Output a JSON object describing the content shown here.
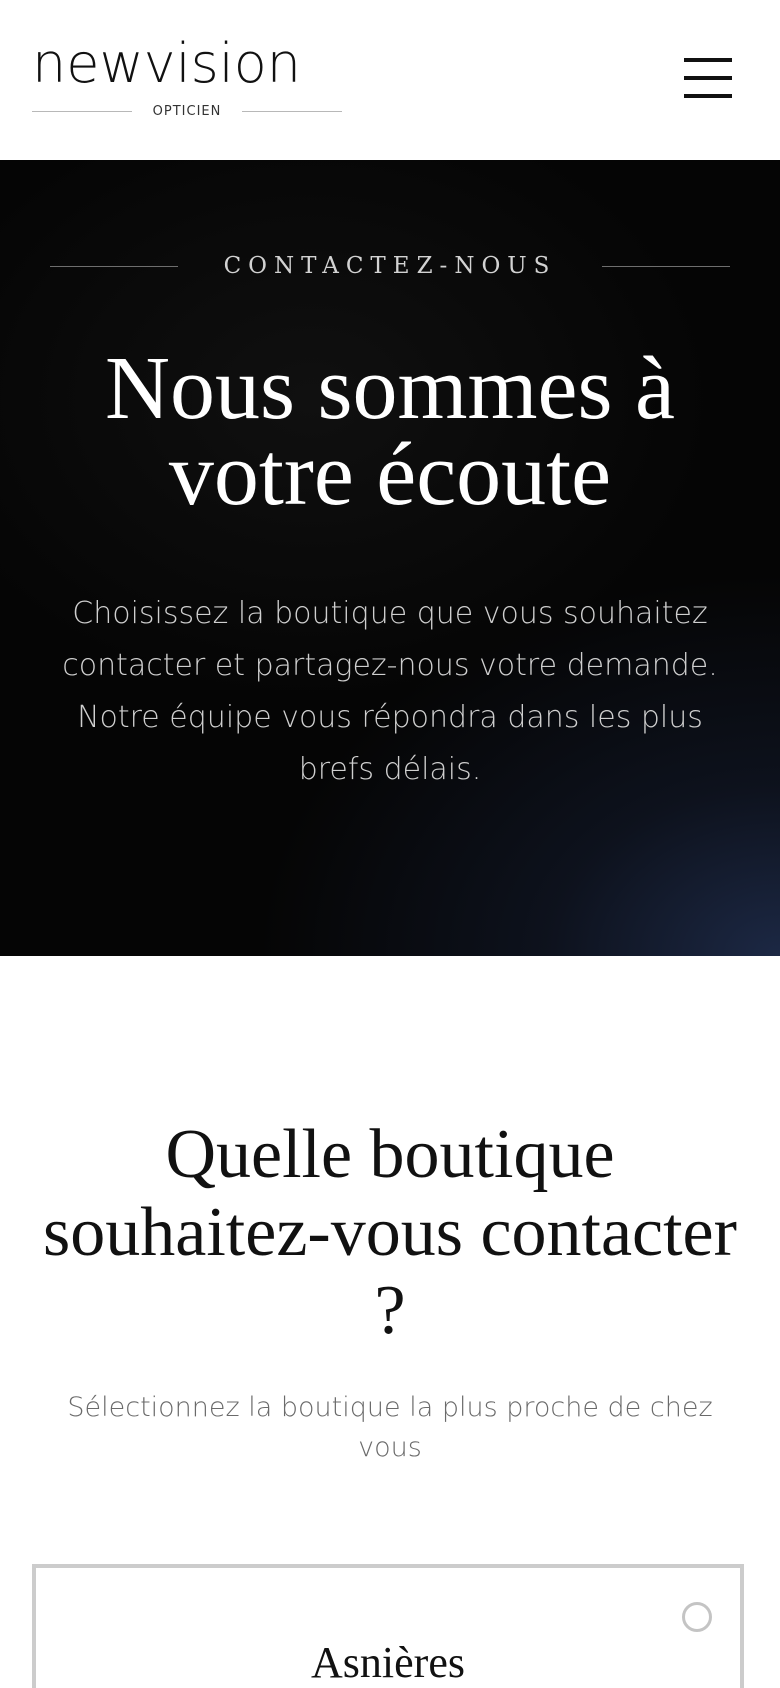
{
  "header": {
    "logo_text": "newvision",
    "logo_subtitle": "OPTICIEN",
    "menu_icon": "hamburger-menu-icon"
  },
  "hero": {
    "eyebrow": "CONTACTEZ-NOUS",
    "title": "Nous sommes à votre écoute",
    "description": "Choisissez la boutique que vous souhaitez contacter et partagez-nous votre demande. Notre équipe vous répondra dans les plus brefs délais."
  },
  "store_section": {
    "title": "Quelle boutique souhaitez-vous contacter ?",
    "subtitle": "Sélectionnez la boutique la plus proche de chez vous",
    "stores": [
      {
        "name": "Asnières",
        "selected": false
      }
    ]
  },
  "colors": {
    "hero_background": "#050505",
    "hero_glow": "#1c2844",
    "text_dark": "#111111",
    "card_border": "#cccccc"
  }
}
